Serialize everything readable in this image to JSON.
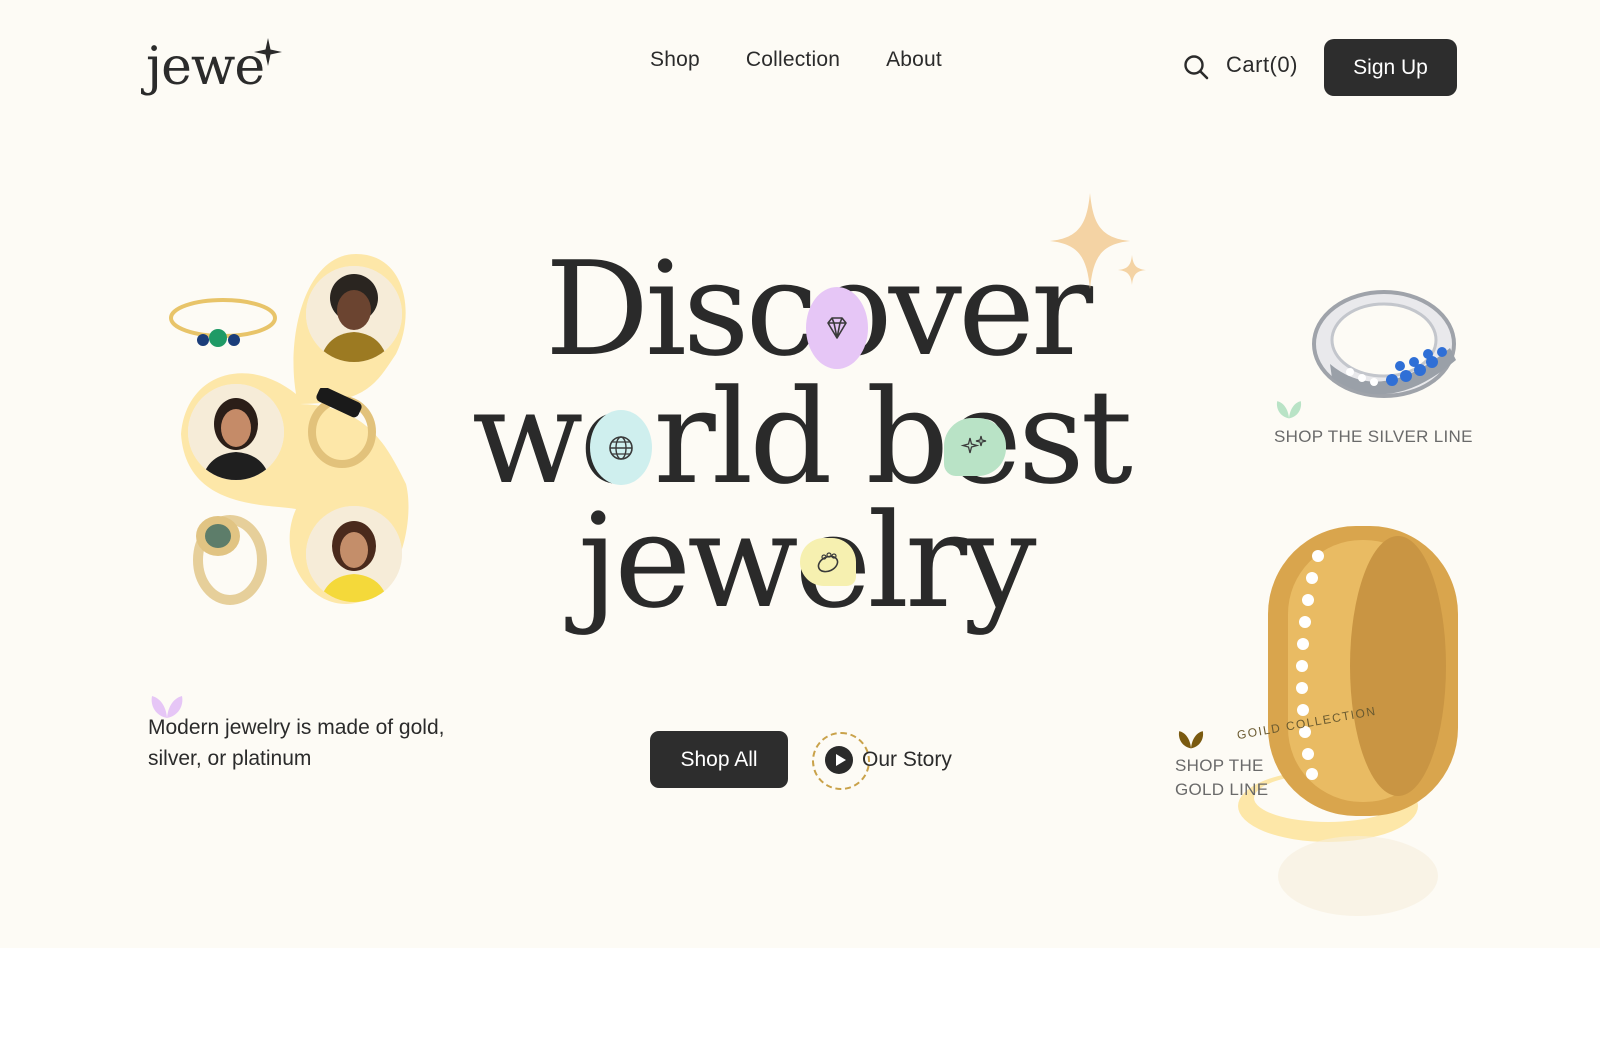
{
  "brand": {
    "logo_text": "jewe"
  },
  "nav": {
    "links": [
      {
        "label": "Shop"
      },
      {
        "label": "Collection"
      },
      {
        "label": "About"
      }
    ],
    "cart_label": "Cart(0)",
    "signup_label": "Sign Up"
  },
  "hero": {
    "line1": "Discover",
    "line2": "world best",
    "line3": "jewelry",
    "description": "Modern jewelry is made of gold, silver, or platinum",
    "shop_all_label": "Shop All",
    "our_story_label": "Our Story"
  },
  "products": {
    "silver": {
      "label": "SHOP THE SILVER LINE"
    },
    "gold": {
      "label": "SHOP THE GOLD LINE",
      "ribbon": "GOILD COLLECTION"
    }
  },
  "colors": {
    "page_bg": "#fdfbf5",
    "dark": "#2d2d2d",
    "accent_yellow": "#fde7a8",
    "accent_purple": "#e6c6f6",
    "accent_aqua": "#cfefee",
    "accent_green": "#b9e3c6",
    "sparkle": "#f4d3a4"
  },
  "icons": [
    "sparkle-icon",
    "search-icon",
    "diamond-icon",
    "globe-icon",
    "sparkles-icon",
    "ring-icon",
    "leaf-icon",
    "play-icon"
  ]
}
